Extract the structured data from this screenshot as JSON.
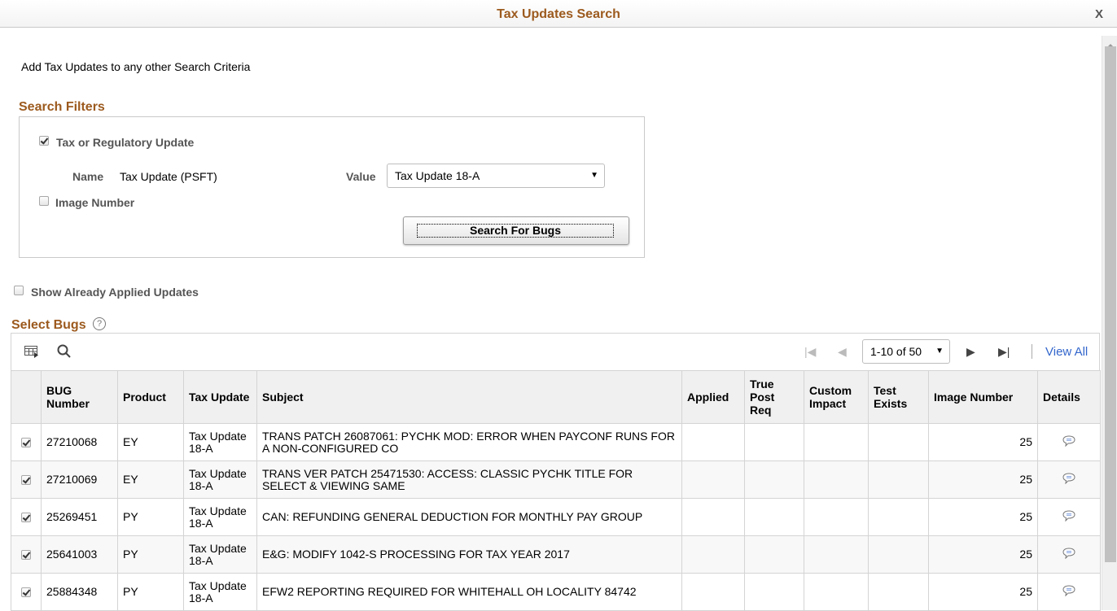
{
  "window": {
    "title": "Tax Updates Search",
    "close_label": "X"
  },
  "intro_text": "Add Tax Updates to any other Search Criteria",
  "search_filters": {
    "title": "Search Filters",
    "tax_update_checkbox": {
      "label": "Tax or Regulatory Update",
      "checked": true
    },
    "name_label": "Name",
    "name_value": "Tax Update (PSFT)",
    "value_label": "Value",
    "value_selected": "Tax Update 18-A",
    "image_number_checkbox": {
      "label": "Image Number",
      "checked": false
    },
    "search_button": "Search For Bugs"
  },
  "show_applied": {
    "label": "Show Already Applied Updates",
    "checked": false
  },
  "select_bugs": {
    "title": "Select Bugs",
    "help_icon": "?",
    "toolbar": {
      "personalize_icon": "grid-personalize-icon",
      "find_icon": "search-icon",
      "page_range": "1-10 of 50",
      "view_all": "View All"
    },
    "columns": [
      "",
      "BUG Number",
      "Product",
      "Tax Update",
      "Subject",
      "Applied",
      "True Post Req",
      "Custom Impact",
      "Test Exists",
      "Image Number",
      "Details"
    ],
    "rows": [
      {
        "selected": true,
        "bug": "27210068",
        "product": "EY",
        "tax_update": "Tax Update 18-A",
        "subject": "TRANS PATCH 26087061: PYCHK MOD: ERROR WHEN PAYCONF RUNS FOR A NON-CONFIGURED CO",
        "applied": "",
        "true_post_req": "",
        "custom_impact": "",
        "test_exists": "",
        "image_number": "25"
      },
      {
        "selected": true,
        "bug": "27210069",
        "product": "EY",
        "tax_update": "Tax Update 18-A",
        "subject": "TRANS VER PATCH 25471530: ACCESS: CLASSIC PYCHK TITLE FOR SELECT & VIEWING SAME",
        "applied": "",
        "true_post_req": "",
        "custom_impact": "",
        "test_exists": "",
        "image_number": "25"
      },
      {
        "selected": true,
        "bug": "25269451",
        "product": "PY",
        "tax_update": "Tax Update 18-A",
        "subject": "CAN: REFUNDING GENERAL DEDUCTION FOR MONTHLY PAY GROUP",
        "applied": "",
        "true_post_req": "",
        "custom_impact": "",
        "test_exists": "",
        "image_number": "25"
      },
      {
        "selected": true,
        "bug": "25641003",
        "product": "PY",
        "tax_update": "Tax Update 18-A",
        "subject": "E&G: MODIFY 1042-S PROCESSING FOR TAX YEAR 2017",
        "applied": "",
        "true_post_req": "",
        "custom_impact": "",
        "test_exists": "",
        "image_number": "25"
      },
      {
        "selected": true,
        "bug": "25884348",
        "product": "PY",
        "tax_update": "Tax Update 18-A",
        "subject": "EFW2 REPORTING REQUIRED FOR WHITEHALL OH LOCALITY 84742",
        "applied": "",
        "true_post_req": "",
        "custom_impact": "",
        "test_exists": "",
        "image_number": "25"
      }
    ]
  },
  "colors": {
    "accent": "#9c5a1e",
    "link": "#3366cc"
  }
}
